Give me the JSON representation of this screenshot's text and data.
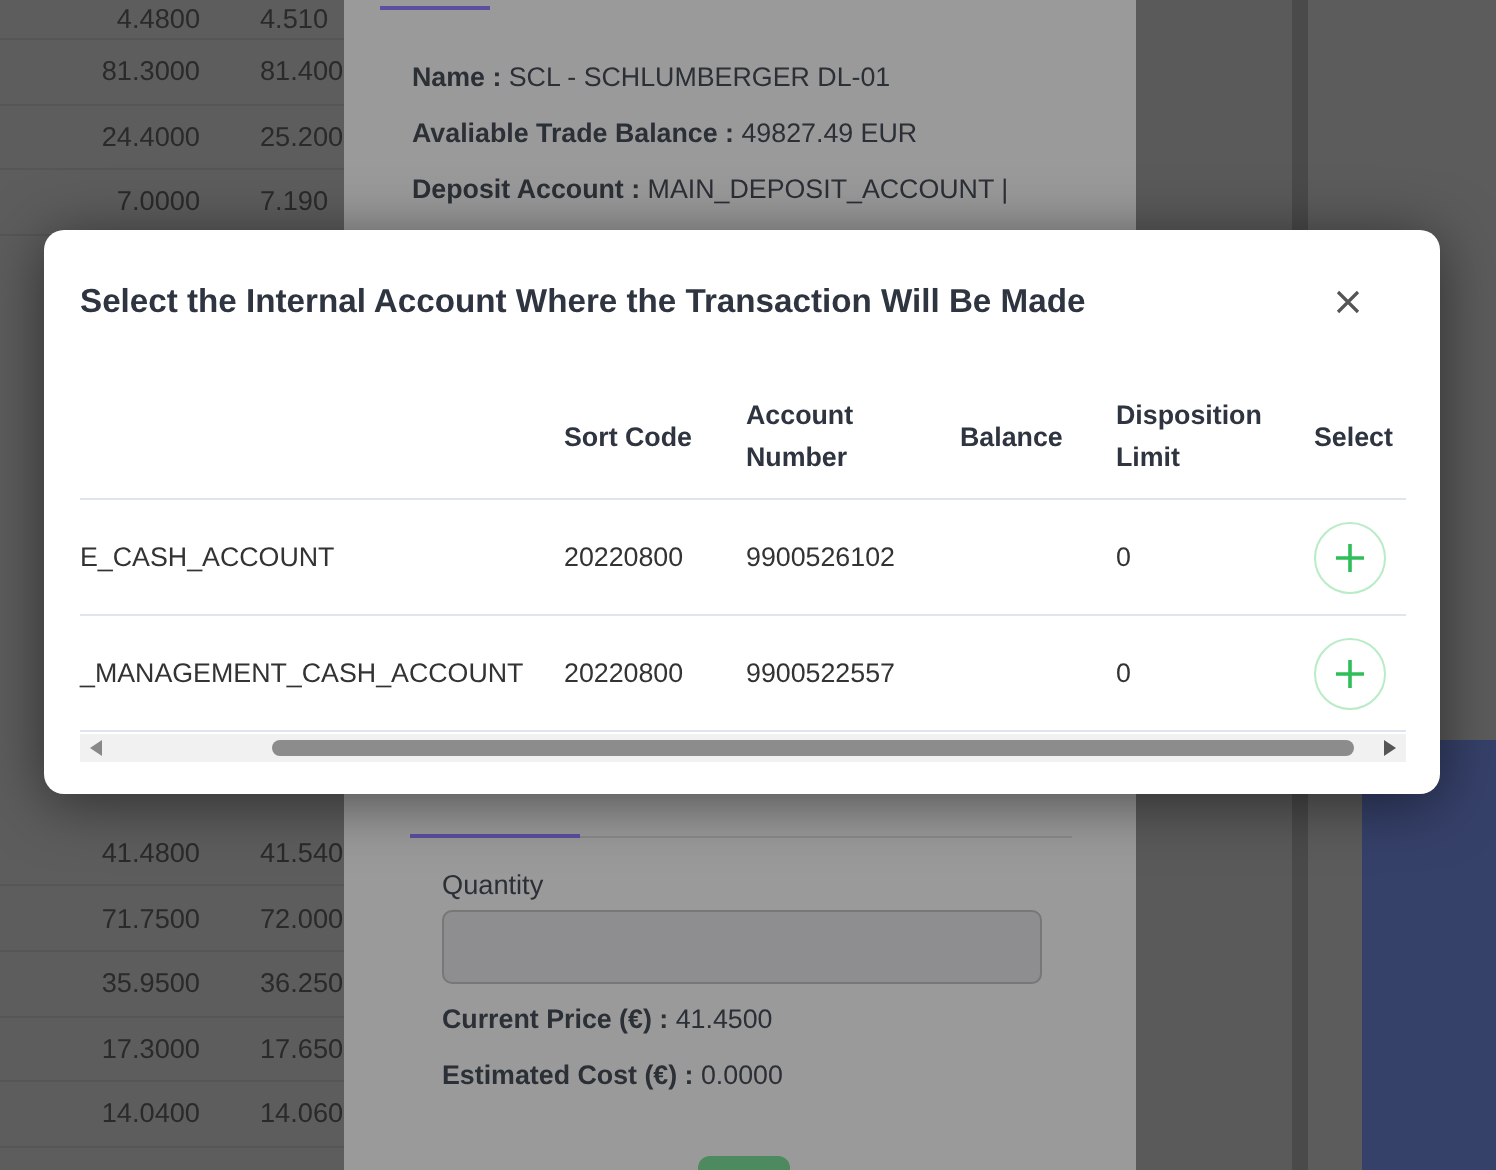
{
  "background_table": {
    "rows_above": [
      {
        "bid": "4.4800",
        "ask": "4.510"
      },
      {
        "bid": "81.3000",
        "ask": "81.400"
      },
      {
        "bid": "24.4000",
        "ask": "25.200"
      },
      {
        "bid": "7.0000",
        "ask": "7.190"
      }
    ],
    "rows_below": [
      {
        "bid": "41.4800",
        "ask": "41.540"
      },
      {
        "bid": "71.7500",
        "ask": "72.000"
      },
      {
        "bid": "35.9500",
        "ask": "36.250"
      },
      {
        "bid": "17.3000",
        "ask": "17.650"
      },
      {
        "bid": "14.0400",
        "ask": "14.060"
      }
    ]
  },
  "order_panel": {
    "details": [
      {
        "label": "Name :",
        "value": "SCL - SCHLUMBERGER DL-01"
      },
      {
        "label": "Avaliable Trade Balance :",
        "value": "49827.49 EUR"
      },
      {
        "label": "Deposit Account :",
        "value": "MAIN_DEPOSIT_ACCOUNT |"
      }
    ],
    "quantity": {
      "label": "Quantity"
    },
    "summary": [
      {
        "label": "Current Price (€) :",
        "value": "41.4500"
      },
      {
        "label": "Estimated Cost (€) :",
        "value": "0.0000"
      }
    ]
  },
  "dialog": {
    "title": "Select the Internal Account Where the Transaction Will Be Made",
    "table": {
      "columns": [
        "Sort Code",
        "Account Number",
        "Balance",
        "Disposition Limit",
        "Select"
      ],
      "rows": [
        {
          "account": "E_CASH_ACCOUNT",
          "sort_code": "20220800",
          "account_number": "9900526102",
          "disposition_limit": "0"
        },
        {
          "account": "_MANAGEMENT_CASH_ACCOUNT",
          "sort_code": "20220800",
          "account_number": "9900522557",
          "disposition_limit": "0"
        }
      ]
    }
  }
}
